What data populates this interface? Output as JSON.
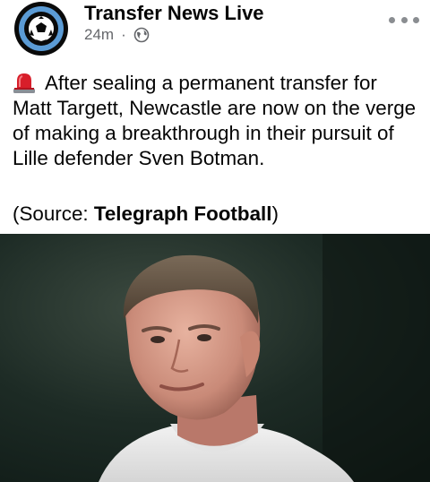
{
  "post": {
    "page_name": "Transfer News Live",
    "timestamp": "24m",
    "separator": "·",
    "privacy_icon": "globe-icon",
    "more_icon": "more-options-icon",
    "siren_icon": "police-siren-emoji",
    "body": "After sealing a permanent transfer for Matt Targett, Newcastle are now on the verge of making a breakthrough in their pursuit of Lille defender Sven Botman.",
    "source_prefix": "(Source: ",
    "source_name": "Telegraph Football",
    "source_suffix": ")"
  },
  "colors": {
    "avatar_ring": "#0a0a0a",
    "avatar_accent": "#5b9bd5",
    "meta_text": "#65676b"
  }
}
